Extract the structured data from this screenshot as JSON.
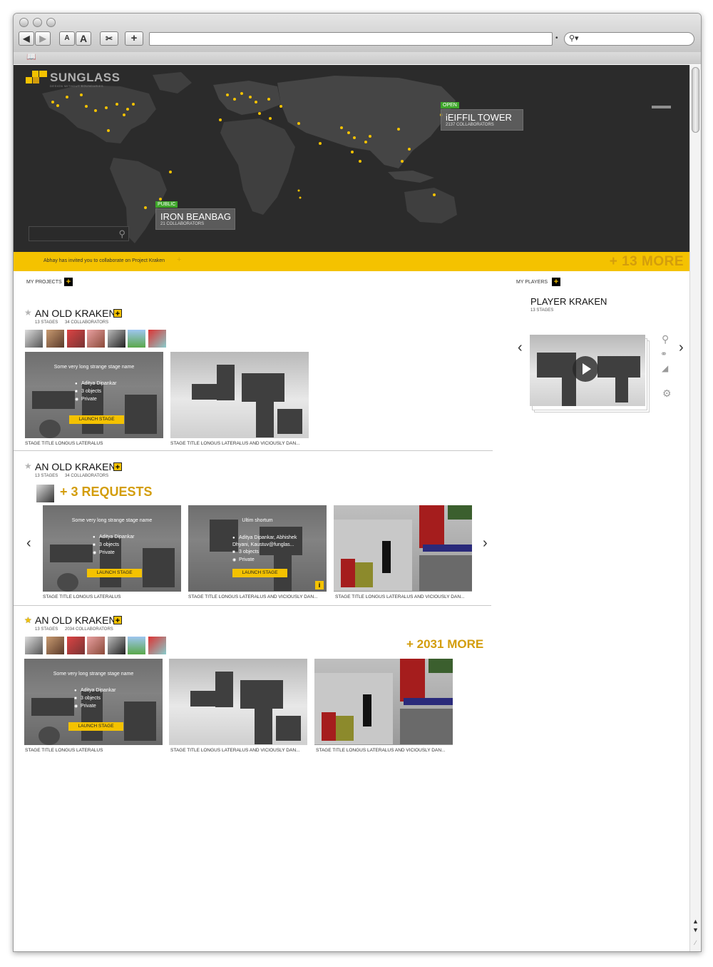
{
  "browser": {
    "font_small": "A",
    "font_large": "A",
    "add_label": "+",
    "search_icon": "magnifier-dropdown-icon"
  },
  "hero": {
    "logo_text": "SUNGLASS",
    "logo_tagline": "DESIGN WITHOUT BOUNDARIES",
    "pins": [
      {
        "tag": "OPEN",
        "title": "iEIFFIL TOWER",
        "subtitle": "2137 COLLABORATORS"
      },
      {
        "tag": "PUBLIC",
        "title": "IRON BEANBAG",
        "subtitle": "21 COLLABORATORS"
      }
    ]
  },
  "notification": {
    "text": "Abhay has invited you to collaborate on Project Kraken",
    "plus": "+",
    "more": "+ 13 MORE"
  },
  "my_projects": {
    "label": "MY PROJECTS",
    "add": "+"
  },
  "my_players": {
    "label": "MY PLAYERS",
    "add": "+",
    "player": {
      "title": "PLAYER KRAKEN",
      "stages": "13 STAGES"
    }
  },
  "projects": [
    {
      "title": "AN OLD KRAKEN",
      "add": "+",
      "stages": "13 STAGES",
      "collaborators": "34 COLLABORATORS",
      "cards": [
        {
          "name": "Some very long strange stage name",
          "owner": "Aditya Dipankar",
          "objects": "3 objects",
          "privacy": "Private",
          "launch": "LAUNCH STAGE",
          "caption": "STAGE TITLE LONGUS LATERALUS"
        },
        {
          "caption": "STAGE TITLE LONGUS LATERALUS AND VICIOUSLY DAN..."
        }
      ]
    },
    {
      "title": "AN OLD KRAKEN",
      "add": "+",
      "stages": "13 STAGES",
      "collaborators": "34 COLLABORATORS",
      "requests": "+ 3 REQUESTS",
      "cards": [
        {
          "name": "Some very long strange stage name",
          "owner": "Aditya Dipankar",
          "objects": "3 objects",
          "privacy": "Private",
          "launch": "LAUNCH STAGE",
          "caption": "STAGE TITLE LONGUS LATERALUS"
        },
        {
          "name": "Ultim shortum",
          "owner": "Aditya Dipankar, Abhishek Dhyani, Kaustuv@funglas...",
          "objects": "3 objects",
          "privacy": "Private",
          "launch": "LAUNCH STAGE",
          "info": "i",
          "caption": "STAGE TITLE LONGUS LATERALUS AND VICIOUSLY DAN..."
        },
        {
          "caption": "STAGE TITLE LONGUS LATERALUS AND VICIOUSLY DAN..."
        }
      ]
    },
    {
      "title": "AN OLD KRAKEN",
      "add": "+",
      "stages": "13 STAGES",
      "collaborators": "2034 COLLABORATORS",
      "more": "+ 2031 MORE",
      "cards": [
        {
          "name": "Some very long strange stage name",
          "owner": "Aditya Dipankar",
          "objects": "3 objects",
          "privacy": "Private",
          "launch": "LAUNCH STAGE",
          "caption": "STAGE TITLE LONGUS LATERALUS"
        },
        {
          "caption": "STAGE TITLE LONGUS LATERALUS AND VICIOUSLY DAN..."
        },
        {
          "caption": "STAGE TITLE LONGUS LATERALUS AND VICIOUSLY DAN..."
        }
      ]
    }
  ],
  "colors": {
    "brand_yellow": "#f4c200",
    "dark": "#2b2b2b",
    "accent_text": "#d39d0c",
    "tag_green": "#3ea62a"
  }
}
